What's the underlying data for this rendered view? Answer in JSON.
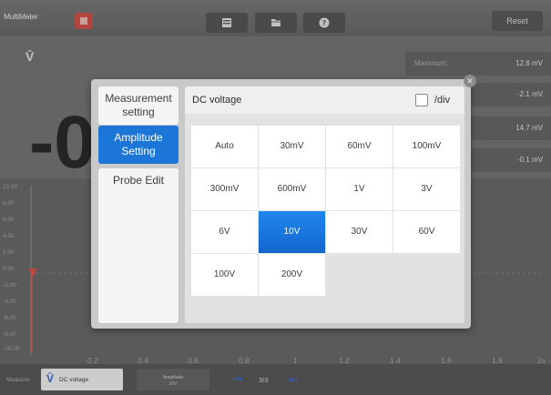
{
  "toolbar": {
    "app_title": "MultiMeter",
    "icons": [
      "stop-icon",
      "print-icon",
      "folder-icon",
      "help-icon"
    ],
    "reset_label": "Reset"
  },
  "measurement": {
    "symbol": "V̄",
    "main_value": "-0",
    "stats": [
      {
        "label": "Maximum:",
        "value": "12.6 mV"
      },
      {
        "label": "",
        "value": "-2.1 mV"
      },
      {
        "label": "",
        "value": "14.7 mV"
      },
      {
        "label": "",
        "value": "-0.1 mV"
      }
    ]
  },
  "chart_data": {
    "type": "line",
    "y_ticks": [
      "10.00",
      "8.00",
      "6.00",
      "4.00",
      "2.00",
      "0.00",
      "-2.00",
      "-4.00",
      "-6.00",
      "-8.00",
      "-10.00"
    ],
    "x_ticks": [
      "0.2",
      "0.4",
      "0.6",
      "0.8",
      "1",
      "1.2",
      "1.4",
      "1.6",
      "1.8",
      "2s"
    ]
  },
  "bottom": {
    "measure_label": "Measure",
    "measure_symbol": "V̄",
    "measure_value": "DC voltage",
    "amplitude_label": "Amplitude",
    "amplitude_value": "10V",
    "page": "3/3"
  },
  "dialog": {
    "tabs": [
      {
        "line1": "Measurement",
        "line2": "setting"
      },
      {
        "line1": "Amplitude",
        "line2": "Setting"
      },
      {
        "line1": "Probe Edit",
        "line2": ""
      }
    ],
    "active_tab": 1,
    "content_title": "DC voltage",
    "div_label": "/div",
    "options": [
      "Auto",
      "30mV",
      "60mV",
      "100mV",
      "300mV",
      "600mV",
      "1V",
      "3V",
      "6V",
      "10V",
      "30V",
      "60V",
      "100V",
      "200V"
    ],
    "selected": "10V",
    "colors": {
      "accent": "#1b76d8",
      "selected": "#1669d2"
    }
  }
}
